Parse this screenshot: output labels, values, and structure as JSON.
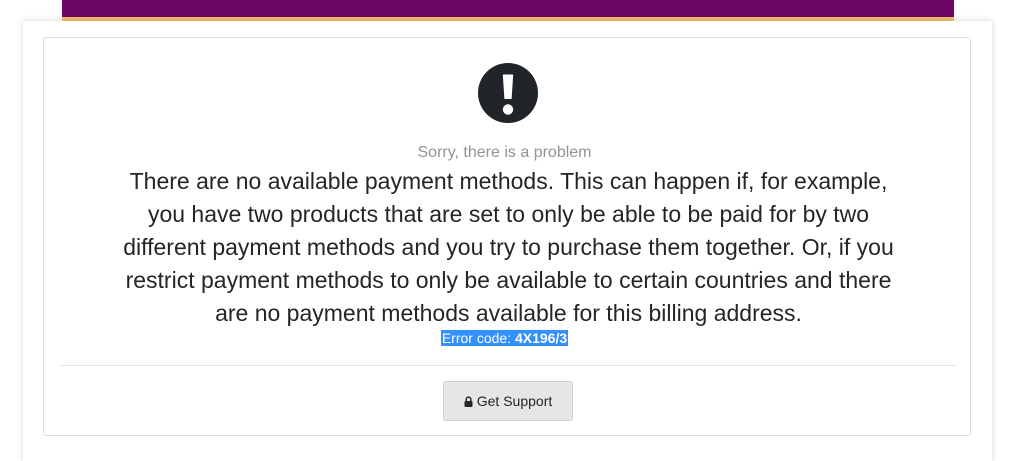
{
  "header": {
    "brand_color": "#6a0664",
    "accent_color": "#f7bf6b"
  },
  "alert": {
    "icon": "exclamation-circle-icon",
    "subtitle": "Sorry, there is a problem",
    "message": "There are no available payment methods. This can happen if, for example, you have two products that are set to only be able to be paid for by two different payment methods and you try to purchase them together. Or, if you restrict payment methods to only be available to certain countries and there are no payment methods available for this billing address.",
    "error_label": "Error code:",
    "error_code": "4X196/3"
  },
  "actions": {
    "support_label": "Get Support",
    "support_icon": "lock-icon"
  }
}
